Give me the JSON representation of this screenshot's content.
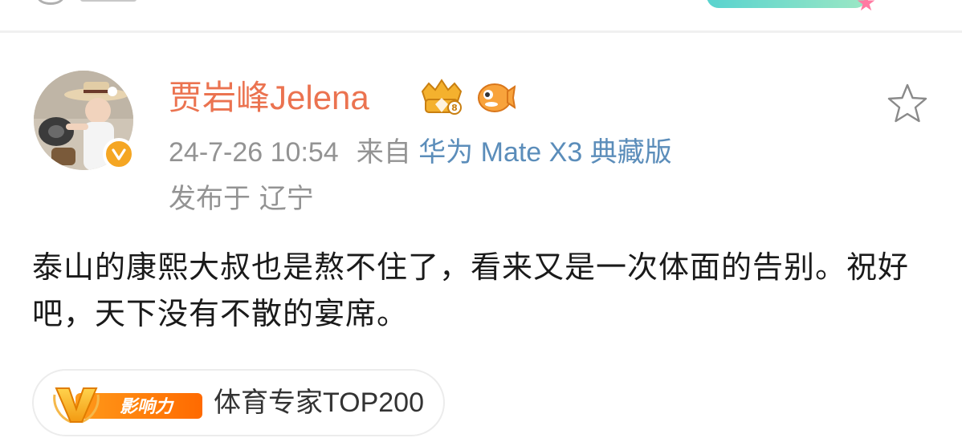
{
  "post": {
    "username": "贾岩峰Jelena",
    "timestamp": "24-7-26 10:54",
    "source_prefix": "来自",
    "device": "华为 Mate X3 典藏版",
    "location": "发布于 辽宁",
    "text": "泰山的康熙大叔也是熬不住了，看来又是一次体面的告别。祝好吧，天下没有不散的宴席。",
    "influence_badge": {
      "letter": "V",
      "label": "影响力"
    },
    "tag_label": "体育专家TOP200"
  },
  "icons": {
    "avatar": "avatar",
    "verified": "verified-icon",
    "crown": "crown-level-icon",
    "fish": "fish-badge-icon",
    "favorite": "star-icon"
  },
  "colors": {
    "username": "#eb7350",
    "meta": "#939393",
    "device_link": "#5b8dba",
    "text": "#1a1a1a",
    "verified": "#f5a623",
    "badge_orange": "#ff8a00"
  }
}
